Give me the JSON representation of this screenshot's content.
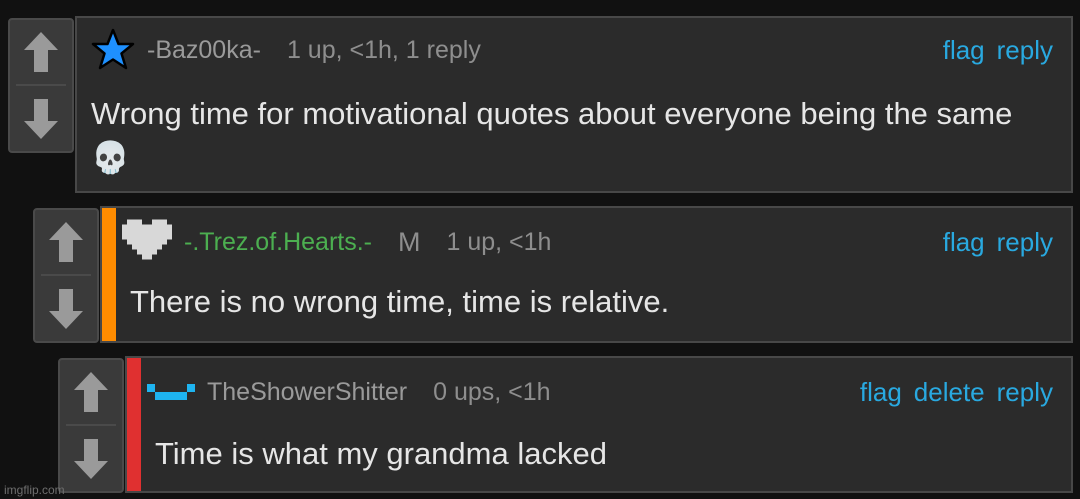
{
  "comments": [
    {
      "username": "-Baz00ka-",
      "meta": "1 up, <1h, 1 reply",
      "actions": [
        "flag",
        "reply"
      ],
      "body": "Wrong time for motivational quotes about everyone being the same 💀",
      "username_color": "#9a9a9a",
      "icon": "blue-star-icon"
    },
    {
      "username": "-.Trez.of.Hearts.-",
      "mod_badge": "M",
      "meta": "1 up, <1h",
      "actions": [
        "flag",
        "reply"
      ],
      "body": "There is no wrong time, time is relative.",
      "username_color": "#4caf50",
      "bar_color": "#ff8c00",
      "icon": "pixel-heart-icon"
    },
    {
      "username": "TheShowerShitter",
      "meta": "0 ups, <1h",
      "actions": [
        "flag",
        "delete",
        "reply"
      ],
      "body": "Time is what my grandma lacked",
      "username_color": "#9a9a9a",
      "bar_color": "#e03030",
      "icon": "blue-pixel-face-icon"
    }
  ],
  "watermark": "imgflip.com",
  "colors": {
    "background": "#111111",
    "card": "#2b2b2b",
    "link": "#29a9e0",
    "text": "#e6e6e6",
    "muted": "#8e8e8e"
  }
}
